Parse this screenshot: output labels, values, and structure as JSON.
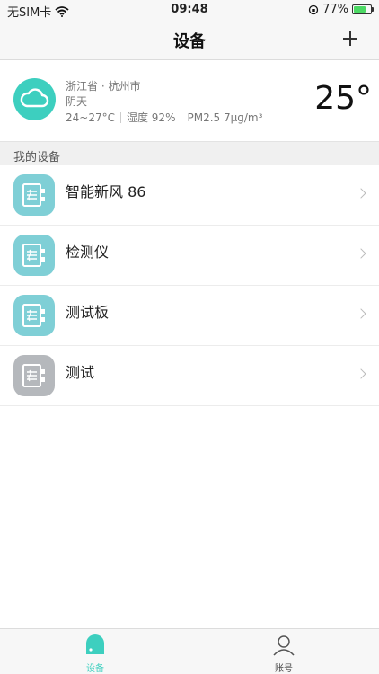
{
  "status_bar": {
    "carrier": "无SIM卡",
    "time": "09:48",
    "battery_percent_text": "77%",
    "battery_level": 0.77
  },
  "nav": {
    "title": "设备"
  },
  "weather": {
    "location": "浙江省 · 杭州市",
    "condition": "阴天",
    "temp_range": "24~27°C",
    "humidity": "湿度 92%",
    "pm25": "PM2.5 7μg/m³",
    "temperature": "25°",
    "icon": "cloud-icon",
    "icon_color": "#3dcfbf"
  },
  "devices_section": {
    "title": "我的设备"
  },
  "devices": [
    {
      "name": "智能新风 86",
      "status_color": "#7fcfd6",
      "icon": "fresh-air-device-icon"
    },
    {
      "name": "检测仪",
      "status_color": "#7fcfd6",
      "icon": "fresh-air-device-icon"
    },
    {
      "name": "测试板",
      "status_color": "#7fcfd6",
      "icon": "fresh-air-device-icon"
    },
    {
      "name": "测试",
      "status_color": "#b5b8bc",
      "icon": "fresh-air-device-icon"
    }
  ],
  "tabbar": {
    "tabs": [
      {
        "label": "设备",
        "icon": "device-tab-icon",
        "active": true
      },
      {
        "label": "账号",
        "icon": "person-icon",
        "active": false
      }
    ],
    "active_color": "#3dcfbf"
  }
}
